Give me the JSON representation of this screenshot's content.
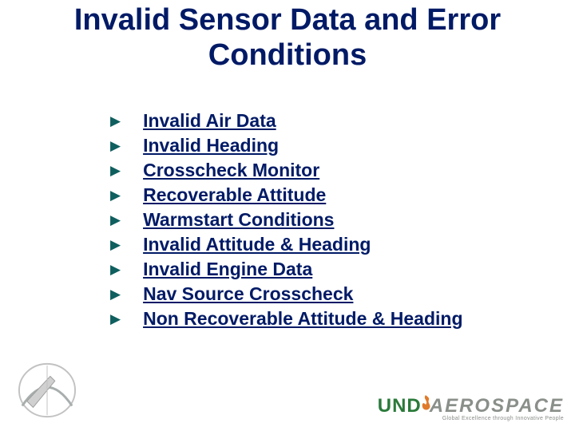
{
  "title": {
    "line1": "Invalid Sensor Data and Error",
    "line2": "Conditions"
  },
  "items": [
    {
      "label": "Invalid Air Data"
    },
    {
      "label": "Invalid Heading"
    },
    {
      "label": "Crosscheck Monitor"
    },
    {
      "label": "Recoverable Attitude"
    },
    {
      "label": "Warmstart Conditions"
    },
    {
      "label": "Invalid Attitude & Heading"
    },
    {
      "label": "Invalid Engine Data"
    },
    {
      "label": "Nav Source Crosscheck"
    },
    {
      "label": "Non Recoverable Attitude & Heading"
    }
  ],
  "footer": {
    "brand_left": "UND",
    "brand_right": "AEROSPACE",
    "tagline": "Global Excellence through Innovative People"
  }
}
